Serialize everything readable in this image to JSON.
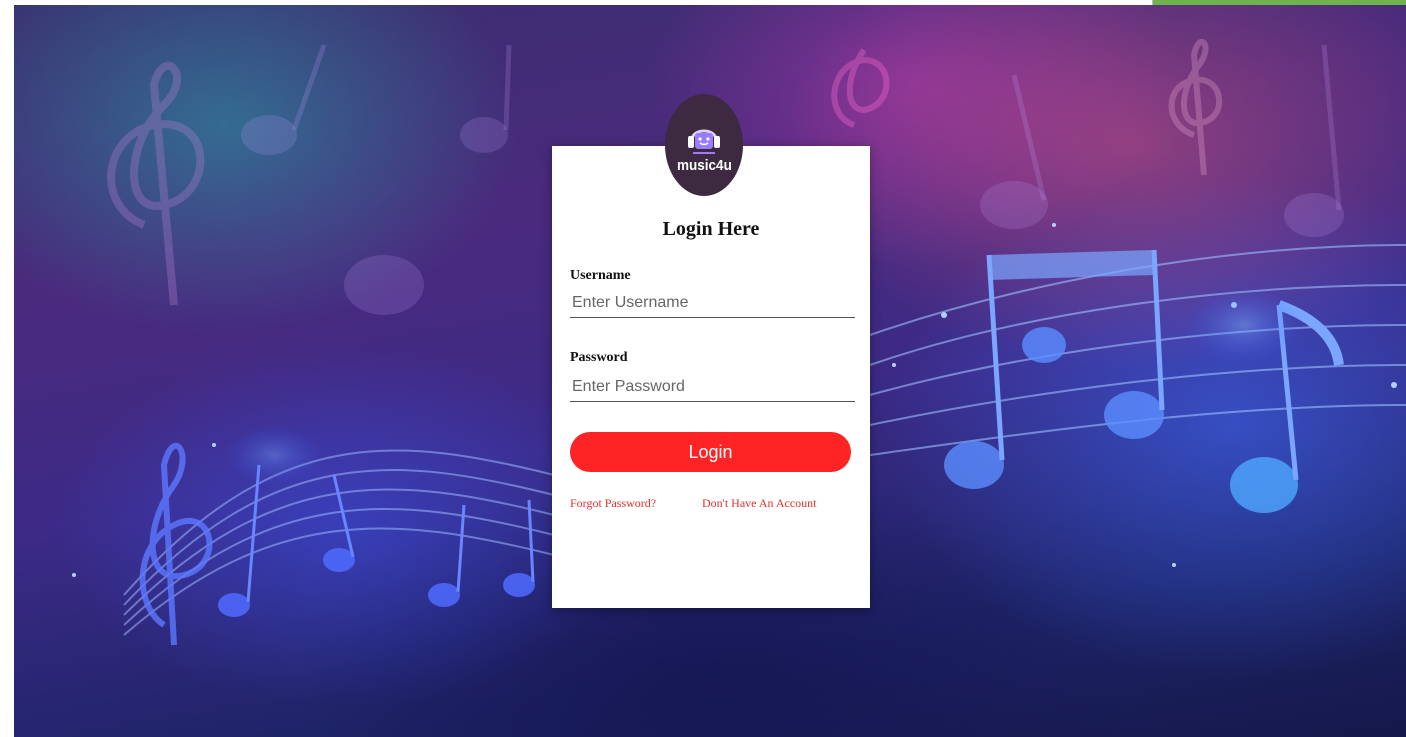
{
  "brand": {
    "name": "music4u"
  },
  "login": {
    "title": "Login Here",
    "username_label": "Username",
    "username_placeholder": "Enter Username",
    "password_label": "Password",
    "password_placeholder": "Enter Password",
    "login_button": "Login",
    "forgot_link": "Forgot Password?",
    "signup_link": "Don't Have An Account"
  },
  "colors": {
    "button": "#fe2425",
    "link": "#e0322a",
    "logo_bg": "#3d2940"
  }
}
